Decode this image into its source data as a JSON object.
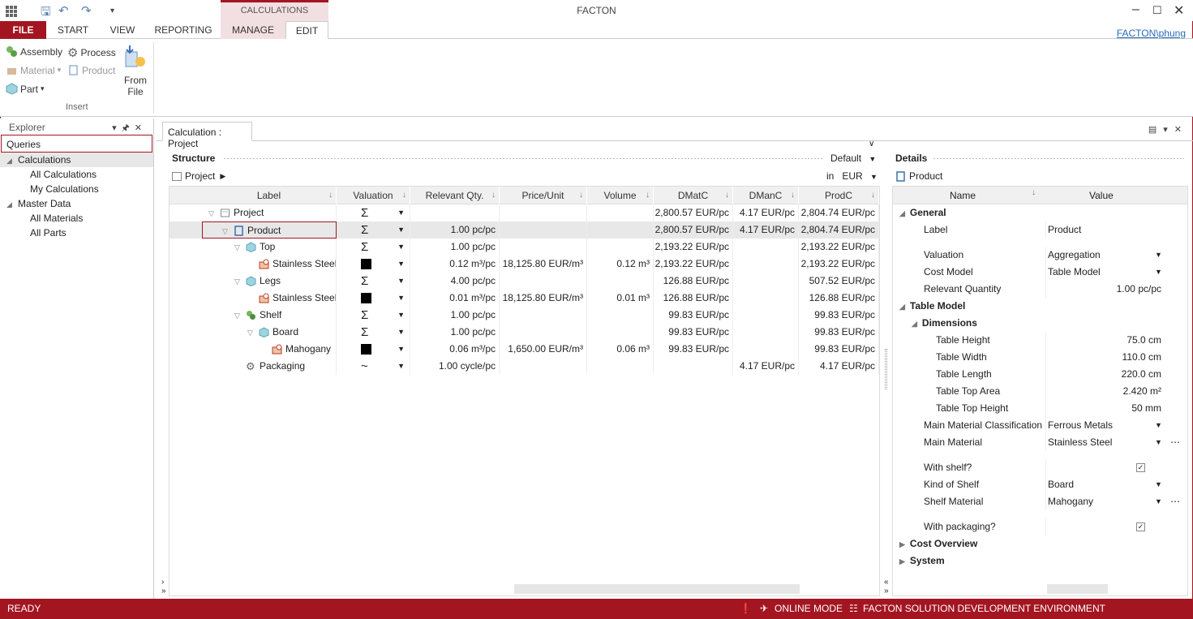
{
  "window": {
    "title": "FACTON",
    "context_tab_group": "CALCULATIONS",
    "user": "FACTON\\phung"
  },
  "tabs": [
    {
      "label": "FILE"
    },
    {
      "label": "START"
    },
    {
      "label": "VIEW"
    },
    {
      "label": "REPORTING"
    },
    {
      "label": "MANAGE"
    },
    {
      "label": "EDIT"
    }
  ],
  "ribbon": {
    "assembly": "Assembly",
    "process": "Process",
    "material": "Material",
    "product": "Product",
    "part": "Part",
    "from_file": "From File",
    "group_label": "Insert"
  },
  "explorer": {
    "title": "Explorer",
    "queries": "Queries",
    "calculations": "Calculations",
    "all_calculations": "All Calculations",
    "my_calculations": "My Calculations",
    "master_data": "Master Data",
    "all_materials": "All Materials",
    "all_parts": "All Parts"
  },
  "document": {
    "tab": "Calculation : Project"
  },
  "structure": {
    "title": "Structure",
    "view": "Default",
    "root": "Project",
    "currency_prefix": "in",
    "currency": "EUR"
  },
  "columns": [
    "Label",
    "Valuation",
    "Relevant Qty.",
    "Price/Unit",
    "Volume",
    "DMatC",
    "DManC",
    "ProdC"
  ],
  "rows": [
    {
      "label": "Project",
      "indent": 0,
      "icon": "project-icon",
      "val": "Σ",
      "qty": "",
      "price": "",
      "volume": "",
      "dmat": "2,800.57 EUR/pc",
      "dman": "4.17 EUR/pc",
      "prod": "2,804.74 EUR/pc",
      "expanded": true
    },
    {
      "label": "Product",
      "indent": 1,
      "icon": "product-icon",
      "val": "Σ",
      "qty": "1.00 pc/pc",
      "price": "",
      "volume": "",
      "dmat": "2,800.57 EUR/pc",
      "dman": "4.17 EUR/pc",
      "prod": "2,804.74 EUR/pc",
      "expanded": true,
      "selected": true
    },
    {
      "label": "Top",
      "indent": 2,
      "icon": "part-icon",
      "val": "Σ",
      "qty": "1.00 pc/pc",
      "price": "",
      "volume": "",
      "dmat": "2,193.22 EUR/pc",
      "dman": "",
      "prod": "2,193.22 EUR/pc",
      "expanded": true
    },
    {
      "label": "Stainless Steel",
      "indent": 3,
      "icon": "material-icon",
      "val": "■",
      "qty": "0.12 m³/pc",
      "price": "18,125.80 EUR/m³",
      "volume": "0.12 m³",
      "dmat": "2,193.22 EUR/pc",
      "dman": "",
      "prod": "2,193.22 EUR/pc"
    },
    {
      "label": "Legs",
      "indent": 2,
      "icon": "part-icon",
      "val": "Σ",
      "qty": "4.00 pc/pc",
      "price": "",
      "volume": "",
      "dmat": "126.88 EUR/pc",
      "dman": "",
      "prod": "507.52 EUR/pc",
      "expanded": true
    },
    {
      "label": "Stainless Steel",
      "indent": 3,
      "icon": "material-icon",
      "val": "■",
      "qty": "0.01 m³/pc",
      "price": "18,125.80 EUR/m³",
      "volume": "0.01 m³",
      "dmat": "126.88 EUR/pc",
      "dman": "",
      "prod": "126.88 EUR/pc"
    },
    {
      "label": "Shelf",
      "indent": 2,
      "icon": "assembly-icon",
      "val": "Σ",
      "qty": "1.00 pc/pc",
      "price": "",
      "volume": "",
      "dmat": "99.83 EUR/pc",
      "dman": "",
      "prod": "99.83 EUR/pc",
      "expanded": true
    },
    {
      "label": "Board",
      "indent": 3,
      "icon": "part-icon",
      "val": "Σ",
      "qty": "1.00 pc/pc",
      "price": "",
      "volume": "",
      "dmat": "99.83 EUR/pc",
      "dman": "",
      "prod": "99.83 EUR/pc",
      "expanded": true
    },
    {
      "label": "Mahogany",
      "indent": 4,
      "icon": "material-icon",
      "val": "■",
      "qty": "0.06 m³/pc",
      "price": "1,650.00 EUR/m³",
      "volume": "0.06 m³",
      "dmat": "99.83 EUR/pc",
      "dman": "",
      "prod": "99.83 EUR/pc"
    },
    {
      "label": "Packaging",
      "indent": 2,
      "icon": "process-icon",
      "val": "~",
      "qty": "1.00 cycle/pc",
      "price": "",
      "volume": "",
      "dmat": "",
      "dman": "4.17 EUR/pc",
      "prod": "4.17 EUR/pc"
    }
  ],
  "details": {
    "title": "Details",
    "object": "Product",
    "col_name": "Name",
    "col_value": "Value",
    "items": [
      {
        "type": "group",
        "label": "General",
        "level": 0
      },
      {
        "label": "Label",
        "value": "Product",
        "level": 1
      },
      {
        "label": "Valuation",
        "value": "Aggregation",
        "level": 1,
        "dropdown": true
      },
      {
        "label": "Cost Model",
        "value": "Table Model",
        "level": 1,
        "dropdown": true
      },
      {
        "label": "Relevant Quantity",
        "value": "1.00 pc/pc",
        "level": 1,
        "right": true
      },
      {
        "type": "group",
        "label": "Table Model",
        "level": 0
      },
      {
        "type": "group",
        "label": "Dimensions",
        "level": 1
      },
      {
        "label": "Table Height",
        "value": "75.0 cm",
        "level": 2,
        "right": true
      },
      {
        "label": "Table Width",
        "value": "110.0 cm",
        "level": 2,
        "right": true
      },
      {
        "label": "Table Length",
        "value": "220.0 cm",
        "level": 2,
        "right": true
      },
      {
        "label": "Table Top Area",
        "value": "2.420 m²",
        "level": 2,
        "right": true
      },
      {
        "label": "Table Top Height",
        "value": "50 mm",
        "level": 2,
        "right": true
      },
      {
        "label": "Main Material Classification",
        "value": "Ferrous Metals",
        "level": 1,
        "dropdown": true
      },
      {
        "label": "Main Material",
        "value": "Stainless Steel",
        "level": 1,
        "dropdown": true,
        "more": true
      },
      {
        "label": "With shelf?",
        "value": "✓",
        "level": 1,
        "check": true
      },
      {
        "label": "Kind of Shelf",
        "value": "Board",
        "level": 1,
        "dropdown": true
      },
      {
        "label": "Shelf Material",
        "value": "Mahogany",
        "level": 1,
        "dropdown": true,
        "more": true
      },
      {
        "label": "With packaging?",
        "value": "✓",
        "level": 1,
        "check": true
      },
      {
        "type": "group",
        "label": "Cost Overview",
        "level": 0,
        "collapsed": true
      },
      {
        "type": "group",
        "label": "System",
        "level": 0,
        "collapsed": true
      }
    ]
  },
  "status": {
    "ready": "READY",
    "mode": "ONLINE MODE",
    "env": "FACTON SOLUTION DEVELOPMENT ENVIRONMENT"
  },
  "colors": {
    "accent": "#a31621",
    "selection": "#e8e8e8"
  }
}
